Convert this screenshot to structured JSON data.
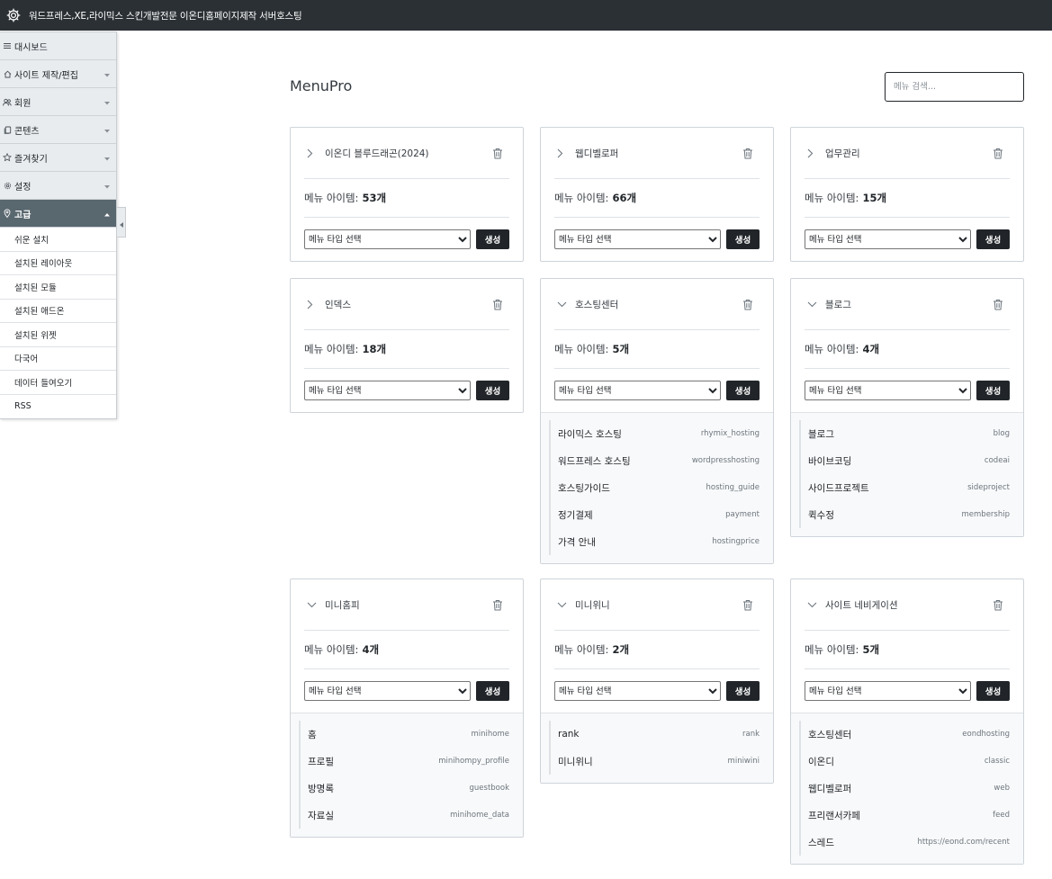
{
  "topbar": {
    "title": "워드프레스,XE,라이믹스 스킨개발전문 이온디홈페이지제작 서버호스팅",
    "icon": "gear-icon"
  },
  "sidebar": {
    "items": [
      {
        "label": "대시보드",
        "icon": "list-icon",
        "chevron": false
      },
      {
        "label": "사이트 제작/편집",
        "icon": "home-icon",
        "chevron": true
      },
      {
        "label": "회원",
        "icon": "users-icon",
        "chevron": true
      },
      {
        "label": "콘텐츠",
        "icon": "copy-icon",
        "chevron": true
      },
      {
        "label": "즐겨찾기",
        "icon": "star-icon",
        "chevron": true
      },
      {
        "label": "설정",
        "icon": "cog-icon",
        "chevron": true
      },
      {
        "label": "고급",
        "icon": "pin-icon",
        "chevron": true,
        "active": true
      }
    ],
    "subitems": [
      "쉬운 설치",
      "설치된 레이아웃",
      "설치된 모듈",
      "설치된 애드온",
      "설치된 위젯",
      "다국어",
      "데이터 들여오기",
      "RSS"
    ]
  },
  "main": {
    "title": "MenuPro",
    "search_placeholder": "메뉴 검색...",
    "count_label": "메뉴 아이템:",
    "select_label": "메뉴 타입 선택",
    "create_label": "생성",
    "cards": [
      {
        "name": "이온디 블루드래곤(2024)",
        "count": "53개",
        "expanded": false,
        "items": []
      },
      {
        "name": "웹디벨로퍼",
        "count": "66개",
        "expanded": false,
        "items": []
      },
      {
        "name": "업무관리",
        "count": "15개",
        "expanded": false,
        "items": []
      },
      {
        "name": "인덱스",
        "count": "18개",
        "expanded": false,
        "items": []
      },
      {
        "name": "호스팅센터",
        "count": "5개",
        "expanded": true,
        "items": [
          {
            "name": "라이믹스 호스팅",
            "slug": "rhymix_hosting"
          },
          {
            "name": "워드프레스 호스팅",
            "slug": "wordpresshosting"
          },
          {
            "name": "호스팅가이드",
            "slug": "hosting_guide"
          },
          {
            "name": "정기결제",
            "slug": "payment"
          },
          {
            "name": "가격 안내",
            "slug": "hostingprice"
          }
        ]
      },
      {
        "name": "블로그",
        "count": "4개",
        "expanded": true,
        "items": [
          {
            "name": "블로그",
            "slug": "blog"
          },
          {
            "name": "바이브코딩",
            "slug": "codeai"
          },
          {
            "name": "사이드프로젝트",
            "slug": "sideproject"
          },
          {
            "name": "퀵수정",
            "slug": "membership"
          }
        ]
      },
      {
        "name": "미니홈피",
        "count": "4개",
        "expanded": true,
        "items": [
          {
            "name": "홈",
            "slug": "minihome"
          },
          {
            "name": "프로필",
            "slug": "minihompy_profile"
          },
          {
            "name": "방명록",
            "slug": "guestbook"
          },
          {
            "name": "자료실",
            "slug": "minihome_data"
          }
        ]
      },
      {
        "name": "미니위니",
        "count": "2개",
        "expanded": true,
        "items": [
          {
            "name": "rank",
            "slug": "rank"
          },
          {
            "name": "미니위니",
            "slug": "miniwini"
          }
        ]
      },
      {
        "name": "사이트 네비게이션",
        "count": "5개",
        "expanded": true,
        "items": [
          {
            "name": "호스팅센터",
            "slug": "eondhosting"
          },
          {
            "name": "이온디",
            "slug": "classic"
          },
          {
            "name": "웹디벨로퍼",
            "slug": "web"
          },
          {
            "name": "프리랜서카페",
            "slug": "feed"
          },
          {
            "name": "스레드",
            "slug": "https://eond.com/recent"
          }
        ]
      }
    ]
  }
}
